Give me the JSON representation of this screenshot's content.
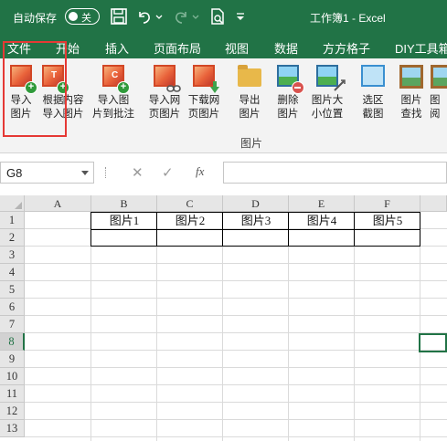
{
  "titlebar": {
    "autosave_label": "自动保存",
    "autosave_state": "关",
    "doc_title": "工作簿1  -  Excel"
  },
  "tabs": [
    "文件",
    "开始",
    "插入",
    "页面布局",
    "视图",
    "数据",
    "方方格子",
    "DIY工具箱"
  ],
  "ribbon": {
    "buttons": [
      {
        "label": "导入\n图片",
        "icon": "import-picture-icon"
      },
      {
        "label": "根据\n导入",
        "icon": "import-by-text-icon"
      },
      {
        "label": "内容\n图片",
        "icon": "content-picture-icon"
      },
      {
        "label": "导入图\n片到批注",
        "icon": "import-to-comment-icon"
      },
      {
        "label": "导入网\n页图片",
        "icon": "import-web-picture-icon"
      },
      {
        "label": "下载网\n页图片",
        "icon": "download-web-picture-icon"
      },
      {
        "label": "导出\n图片",
        "icon": "export-picture-icon"
      },
      {
        "label": "删除\n图片",
        "icon": "delete-picture-icon"
      },
      {
        "label": "图片大\n小位置",
        "icon": "picture-size-icon"
      },
      {
        "label": "选区\n截图",
        "icon": "screenshot-icon"
      },
      {
        "label": "图片\n查找",
        "icon": "picture-search-icon"
      },
      {
        "label": "图\n阅",
        "icon": "picture-view-icon"
      }
    ],
    "group_label": "图片"
  },
  "formula_bar": {
    "name_box": "G8",
    "cancel_symbol": "✕",
    "enter_symbol": "✓",
    "fx_symbol": "fx",
    "formula_value": ""
  },
  "sheet": {
    "columns": [
      "A",
      "B",
      "C",
      "D",
      "E",
      "F"
    ],
    "rows": [
      "1",
      "2",
      "3",
      "4",
      "5",
      "6",
      "7",
      "8",
      "9",
      "10",
      "11",
      "12",
      "13"
    ],
    "selected_row": "8",
    "cells": {
      "B1": "图片1",
      "C1": "图片2",
      "D1": "图片3",
      "E1": "图片4",
      "F1": "图片5"
    }
  },
  "colors": {
    "accent": "#217346",
    "highlight_box": "#e53935"
  }
}
